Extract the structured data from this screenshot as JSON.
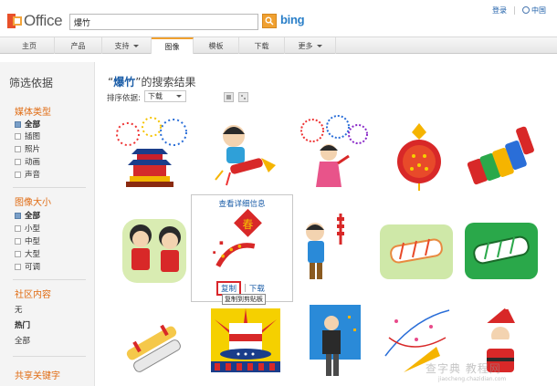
{
  "header": {
    "logo_text": "Office",
    "search_value": "爆竹",
    "bing_label": "bing",
    "login_label": "登录",
    "region_label": "中国"
  },
  "nav": {
    "items": [
      {
        "label": "主页"
      },
      {
        "label": "产品"
      },
      {
        "label": "支持"
      },
      {
        "label": "图像"
      },
      {
        "label": "模板"
      },
      {
        "label": "下载"
      },
      {
        "label": "更多"
      }
    ]
  },
  "sidebar": {
    "title": "筛选依据",
    "media_type": {
      "heading": "媒体类型",
      "options": [
        "全部",
        "插图",
        "照片",
        "动画",
        "声音"
      ]
    },
    "image_size": {
      "heading": "图像大小",
      "options": [
        "全部",
        "小型",
        "中型",
        "大型",
        "可调"
      ]
    },
    "community": {
      "heading": "社区内容",
      "options": [
        "无",
        "热门",
        "全部"
      ]
    },
    "shared_keywords": {
      "heading": "共享关键字"
    }
  },
  "results": {
    "title_prefix": "“",
    "keyword": "爆竹",
    "title_suffix": "”的搜索结果",
    "sort_label": "排序依据:",
    "sort_value": "下载"
  },
  "hover_card": {
    "details_link": "查看详细信息",
    "copy_label": "复制",
    "download_label": "下载",
    "tooltip": "复制到剪贴板"
  },
  "watermark": {
    "text": "查字典 教程网",
    "sub": "jiaocheng.chazidian.com"
  },
  "colors": {
    "accent": "#e06b12",
    "link": "#1c5ea8",
    "highlight_border": "#d9262b"
  }
}
